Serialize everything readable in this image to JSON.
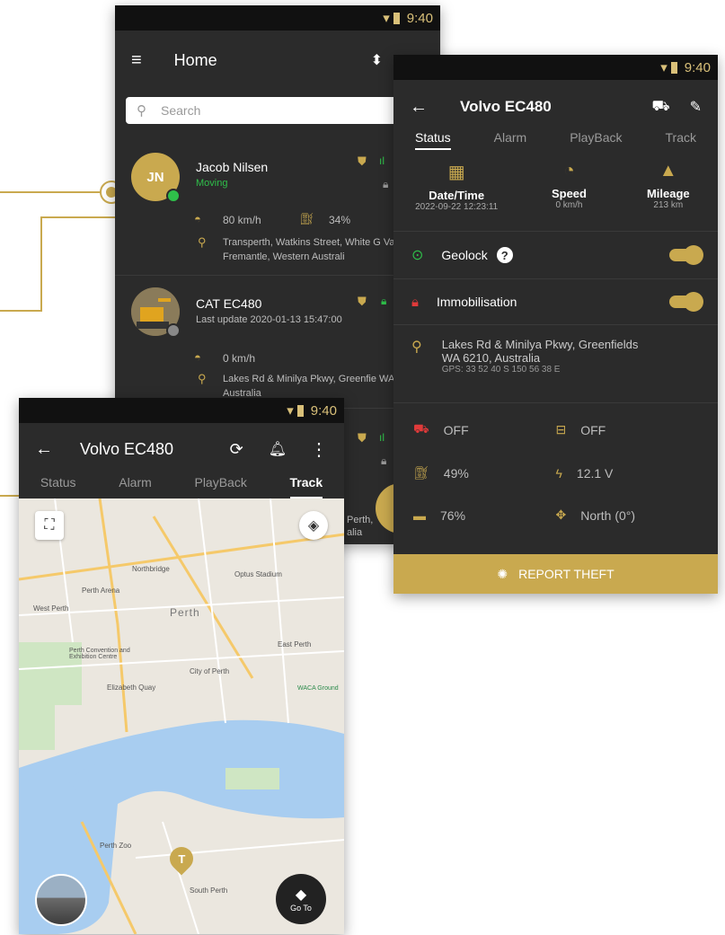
{
  "statusbar": {
    "time": "9:40"
  },
  "home": {
    "title": "Home",
    "search_placeholder": "Search",
    "items": [
      {
        "initials": "JN",
        "name": "Jacob Nilsen",
        "status": "Moving",
        "speed": "80 km/h",
        "fuel": "34%",
        "address": "Transperth, Watkins Street, White G Valley, Fremantle, Western Australi"
      },
      {
        "name": "CAT EC480",
        "status": "Last update 2020-01-13 15:47:00",
        "speed": "0 km/h",
        "address": "Lakes Rd & Minilya Pkwy, Greenfie WA 6210, Australia"
      }
    ],
    "partial_text": "Perth, alia",
    "partial_button": "Vi"
  },
  "detail": {
    "title": "Volvo EC480",
    "tabs": [
      "Status",
      "Alarm",
      "PlayBack",
      "Track"
    ],
    "summary": [
      {
        "label": "Date/Time",
        "value": "2022-09-22 12:23:11"
      },
      {
        "label": "Speed",
        "value": "0 km/h"
      },
      {
        "label": "Mileage",
        "value": "213 km"
      }
    ],
    "geolock_label": "Geolock",
    "immobilisation_label": "Immobilisation",
    "address_line1": "Lakes Rd & Minilya Pkwy, Greenfields",
    "address_line2": "WA 6210, Australia",
    "gps": "GPS: 33 52 40 S 150 56 38 E",
    "stats": [
      "OFF",
      "OFF",
      "49%",
      "12.1 V",
      "76%",
      "North (0°)"
    ],
    "report_label": "REPORT THEFT"
  },
  "track": {
    "title": "Volvo EC480",
    "tabs": [
      "Status",
      "Alarm",
      "PlayBack",
      "Track"
    ],
    "goto_label": "Go To",
    "map_labels": [
      "Perth",
      "Perth Arena",
      "West Perth",
      "Northbridge",
      "Optus Stadium",
      "Perth Convention and Exhibition Centre",
      "City of Perth",
      "East Perth",
      "Elizabeth Quay",
      "WACA Ground",
      "Perth Zoo",
      "South Perth"
    ],
    "marker": "T"
  },
  "colors": {
    "accent": "#c9a94f",
    "dark": "#2b2b2b",
    "online": "#2fbf4a"
  }
}
